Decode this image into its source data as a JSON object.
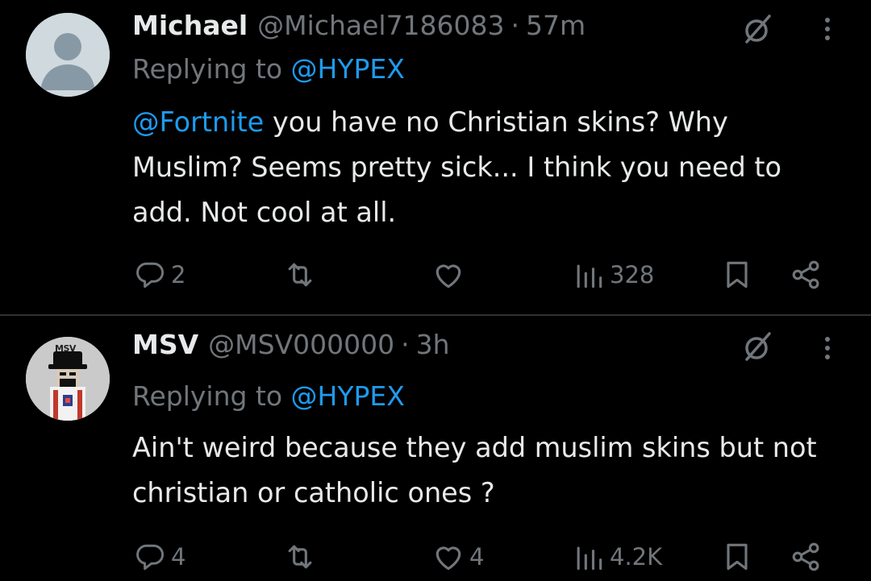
{
  "tweets": [
    {
      "name": "Michael",
      "handle": "@Michael7186083",
      "separator": "·",
      "time": "57m",
      "replying_prefix": "Replying to",
      "replying_to": "@HYPEX",
      "body_mention": "@Fortnite",
      "body_text": " you have no Christian skins? Why Muslim? Seems pretty sick... I think you need to add. Not cool at all.",
      "reply_count": "2",
      "retweet_count": "",
      "like_count": "",
      "view_count": "328"
    },
    {
      "name": "MSV",
      "handle": "@MSV000000",
      "separator": "·",
      "time": "3h",
      "replying_prefix": "Replying to",
      "replying_to": "@HYPEX",
      "body_mention": "",
      "body_text": "Ain't weird because they add muslim skins but not christian or catholic ones ?",
      "reply_count": "4",
      "retweet_count": "",
      "like_count": "4",
      "view_count": "4.2K"
    }
  ],
  "avatar_logo_text": "MSV",
  "icons": {
    "reply": "reply-icon",
    "retweet": "retweet-icon",
    "like": "heart-icon",
    "views": "views-icon",
    "bookmark": "bookmark-icon",
    "share": "share-icon",
    "grok": "grok-icon",
    "more": "more-icon"
  },
  "colors": {
    "background": "#000000",
    "text": "#e7e9ea",
    "muted": "#71767b",
    "link": "#1d9bf0",
    "divider": "#2f3336"
  }
}
